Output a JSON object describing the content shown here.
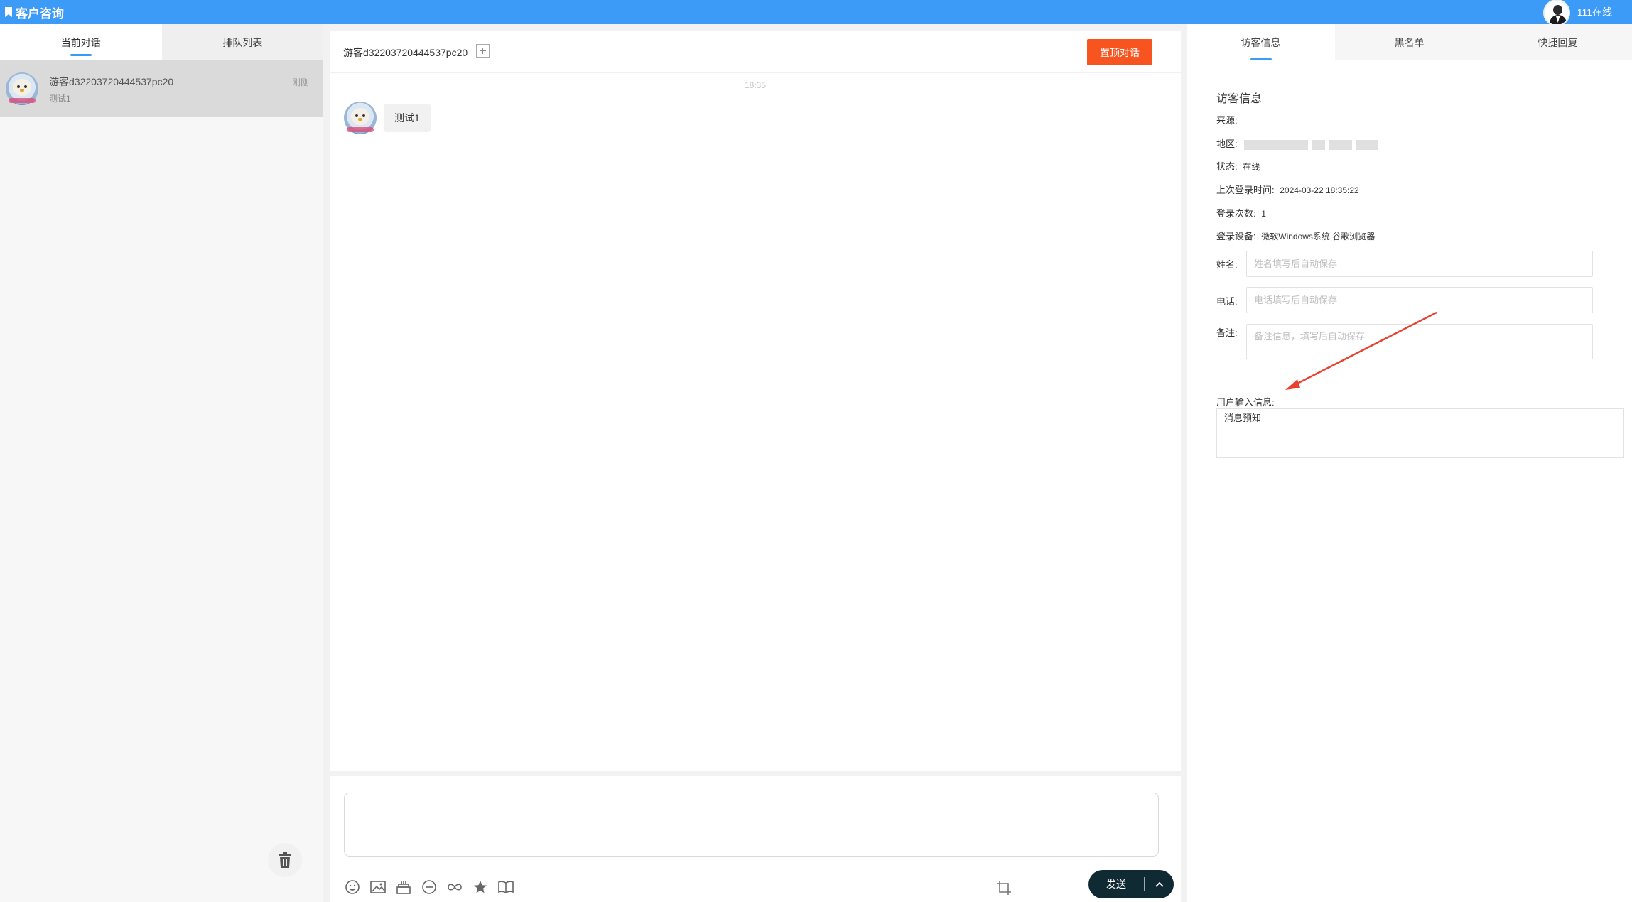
{
  "topbar": {
    "title": "客户咨询",
    "agent_status": "111在线",
    "accent_color": "#3d9bf8"
  },
  "left": {
    "tabs": [
      {
        "label": "当前对话"
      },
      {
        "label": "排队列表"
      }
    ],
    "conversations": [
      {
        "name": "游客d32203720444537pc20",
        "preview": "测试1",
        "time": "刚刚"
      }
    ],
    "trash_icon": "trash-icon"
  },
  "chat": {
    "visitor_title": "游客d32203720444537pc20",
    "pin_button": "置顶对话",
    "pin_color": "#f7541f",
    "time_divider": "18:35",
    "messages": [
      {
        "text": "测试1"
      }
    ]
  },
  "input": {
    "tools": [
      "smile-icon",
      "image-icon",
      "cake-icon",
      "minus-circle-icon",
      "infinity-icon",
      "star-icon",
      "book-icon"
    ],
    "crop_icon": "crop-icon",
    "send_label": "发送"
  },
  "right": {
    "tabs": [
      {
        "label": "访客信息"
      },
      {
        "label": "黑名单"
      },
      {
        "label": "快捷回复"
      }
    ],
    "info_title": "访客信息",
    "source_label": "来源:",
    "source_value": "",
    "region_label": "地区:",
    "status_label": "状态:",
    "status_value": "在线",
    "last_login_label": "上次登录时间:",
    "last_login_value": "2024-03-22 18:35:22",
    "login_count_label": "登录次数:",
    "login_count_value": "1",
    "device_label": "登录设备:",
    "device_value": "微软Windows系统 谷歌浏览器",
    "name_label": "姓名:",
    "name_placeholder": "姓名填写后自动保存",
    "phone_label": "电话:",
    "phone_placeholder": "电话填写后自动保存",
    "note_label": "备注:",
    "note_placeholder": "备注信息，填写后自动保存",
    "user_input_label": "用户输入信息:",
    "user_input_value": "消息预知"
  }
}
